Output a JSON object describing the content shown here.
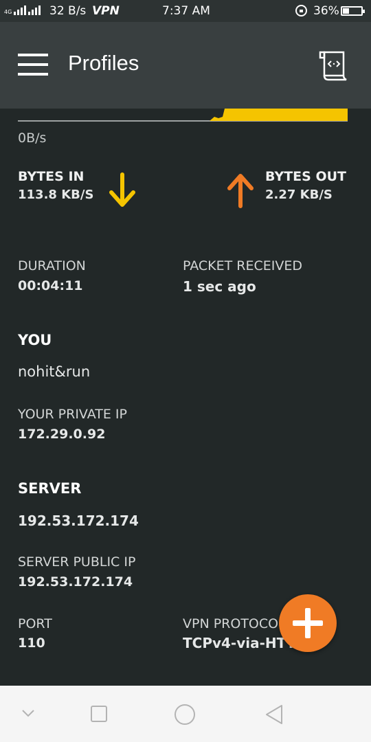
{
  "status_bar": {
    "network": "4G",
    "speed": "32 B/s",
    "vpn": "VPN",
    "time": "7:37 AM",
    "battery": "36%",
    "battery_level": 0.36
  },
  "app_bar": {
    "title": "Profiles",
    "menu_icon": "menu-icon",
    "log_icon": "log-icon"
  },
  "traffic": {
    "graph_speed": "0B/s",
    "bytes_in_label": "BYTES IN",
    "bytes_in_value": "113.8 KB/S",
    "bytes_out_label": "BYTES OUT",
    "bytes_out_value": "2.27 KB/S",
    "in_color": "#f5c400",
    "out_color": "#f07b25"
  },
  "session": {
    "duration_label": "DURATION",
    "duration_value": "00:04:11",
    "packet_label": "PACKET RECEIVED",
    "packet_value": "1 sec ago"
  },
  "you": {
    "heading": "YOU",
    "name": "nohit&run",
    "private_ip_label": "YOUR PRIVATE IP",
    "private_ip_value": "172.29.0.92"
  },
  "server": {
    "heading": "SERVER",
    "name": "192.53.172.174",
    "public_ip_label": "SERVER PUBLIC IP",
    "public_ip_value": "192.53.172.174",
    "port_label": "PORT",
    "port_value": "110",
    "protocol_label": "VPN PROTOCOL",
    "protocol_value": "TCPv4-via-HTTP"
  },
  "fab": {
    "icon": "plus-icon",
    "color": "#f07b25"
  },
  "nav_bar": {
    "icons": [
      "chevron-down-icon",
      "square-icon",
      "circle-icon",
      "triangle-back-icon"
    ]
  }
}
